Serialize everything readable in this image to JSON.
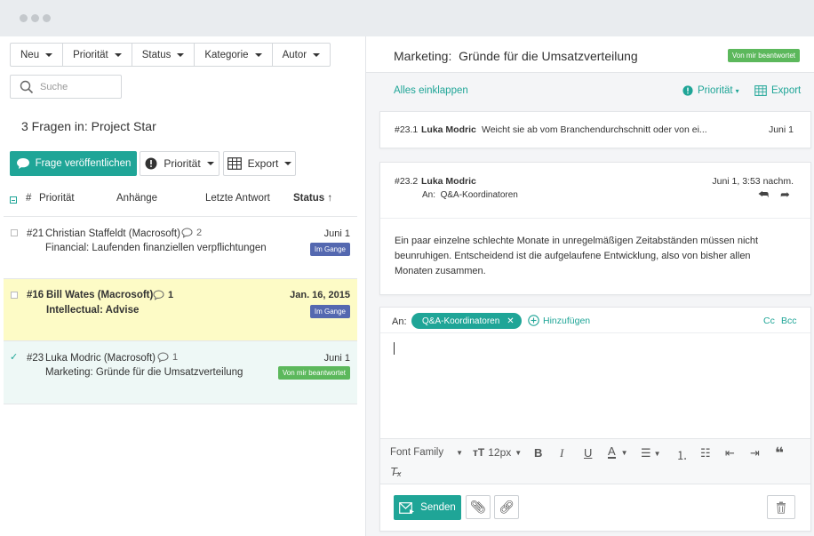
{
  "filters": {
    "neu": "Neu",
    "prioritaet": "Priorität",
    "status": "Status",
    "kategorie": "Kategorie",
    "autor": "Autor"
  },
  "search": {
    "placeholder": "Suche"
  },
  "list": {
    "heading": "3 Fragen in: Project Star",
    "publish_button": "Frage veröffentlichen",
    "priority_button": "Priorität",
    "export_button": "Export",
    "columns": {
      "num": "#",
      "priority": "Priorität",
      "attachments": "Anhänge",
      "last_answer": "Letzte Antwort",
      "status": "Status"
    },
    "rows": [
      {
        "num": "#21",
        "author": "Christian Staffeldt (Macrosoft)",
        "comments": "2",
        "date": "Juni 1",
        "title": "Financial: Laufenden finanziellen verpflichtungen",
        "badge": "Im Gange"
      },
      {
        "num": "#16",
        "author": "Bill Wates (Macrosoft)",
        "comments": "1",
        "date": "Jan. 16, 2015",
        "title": "Intellectual: Advise",
        "badge": "Im Gange"
      },
      {
        "num": "#23",
        "author": "Luka Modric (Macrosoft)",
        "comments": "1",
        "date": "Juni 1",
        "title": "Marketing: Gründe für die Umsatzverteilung",
        "badge": "Von mir beantwortet"
      }
    ]
  },
  "detail": {
    "title_prefix": "Marketing:",
    "title": "Gründe für die Umsatzverteilung",
    "status_badge": "Von mir beantwortet",
    "collapse_all": "Alles einklappen",
    "priority": "Priorität",
    "export": "Export",
    "messages": [
      {
        "num": "#23.1",
        "author": "Luka Modric",
        "preview": "Weicht sie ab vom Branchendurchschnitt oder von ei...",
        "date": "Juni 1"
      },
      {
        "num": "#23.2",
        "author": "Luka Modric",
        "to_label": "An:",
        "to": "Q&A-Koordinatoren",
        "date": "Juni 1, 3:53 nachm.",
        "body": "Ein paar einzelne schlechte Monate in unregelmäßigen Zeitabständen müssen nicht beunruhigen. Entscheidend ist die aufgelaufene Entwicklung, also von bisher allen Monaten zusammen."
      }
    ]
  },
  "reply": {
    "to_label": "An:",
    "recipient": "Q&A-Koordinatoren",
    "add": "Hinzufügen",
    "cc": "Cc",
    "bcc": "Bcc",
    "font_family": "Font Family",
    "font_size": "12px",
    "send": "Senden"
  },
  "colors": {
    "accent": "#1fa597",
    "highlight_row": "#fdfbc6",
    "selected_row": "#eef8f6",
    "badge_blue": "#5468b0",
    "badge_green": "#5cb85c"
  }
}
